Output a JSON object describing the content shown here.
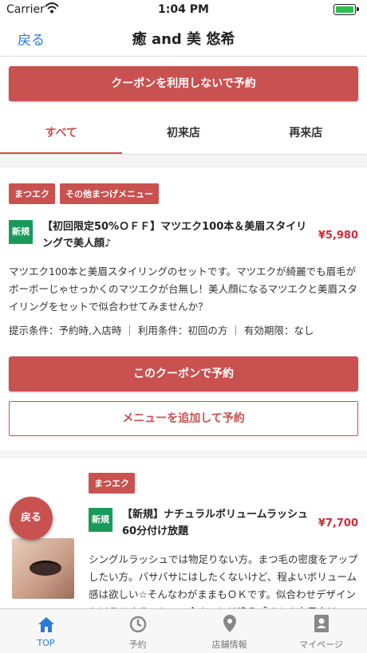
{
  "status": {
    "carrier": "Carrier",
    "time": "1:04 PM"
  },
  "nav": {
    "back": "戻る",
    "title": "癒 and 美 悠希"
  },
  "top_button": "クーポンを利用しないで予約",
  "tabs": [
    "すべて",
    "初来店",
    "再来店"
  ],
  "coupon1": {
    "tags": [
      "まつエク",
      "その他まつげメニュー"
    ],
    "badge": "新規",
    "name": "【初回限定50%ＯＦＦ】マツエク100本＆美眉スタイリングで美人顔♪",
    "price": "¥5,980",
    "description": "マツエク100本と美眉スタイリングのセットです。マツエクが綺麗でも眉毛がボーボーじゃせっかくのマツエクが台無し！美人顔になるマツエクと美眉スタイリングをセットで似合わせてみませんか？",
    "conditions": "提示条件：予約時,入店時 ｜ 利用条件：初回の方 ｜ 有効期限：なし",
    "btn_book": "このクーポンで予約",
    "btn_add": "メニューを追加して予約"
  },
  "coupon2": {
    "tags": [
      "まつエク"
    ],
    "badge": "新規",
    "name": "【新規】ナチュラルボリュームラッシュ60分付け放題",
    "price": "¥7,700",
    "description": "シングルラッシュでは物足りない方。まつ毛の密度をアップしたい方。バサバサにはしたくないけど、程よいボリューム感は欲しい☆そんなわがままもＯＫです。似合わせデザインをＭＩＸすることで、今までとは違う「オトナ女子向け」のおしゃれな印象に仕上がります。ボリュームが初めての方も安心して挑戦していただけますよ"
  },
  "fab": "戻る",
  "tabbar": [
    {
      "label": "TOP",
      "icon": "house-icon"
    },
    {
      "label": "予約",
      "icon": "clock-icon"
    },
    {
      "label": "店舗情報",
      "icon": "map-pin-icon"
    },
    {
      "label": "マイページ",
      "icon": "person-badge-icon"
    }
  ],
  "colors": {
    "accent": "#c9514f",
    "new_badge": "#1a9a5a",
    "price": "#d2283b",
    "link": "#2a7bd6"
  }
}
